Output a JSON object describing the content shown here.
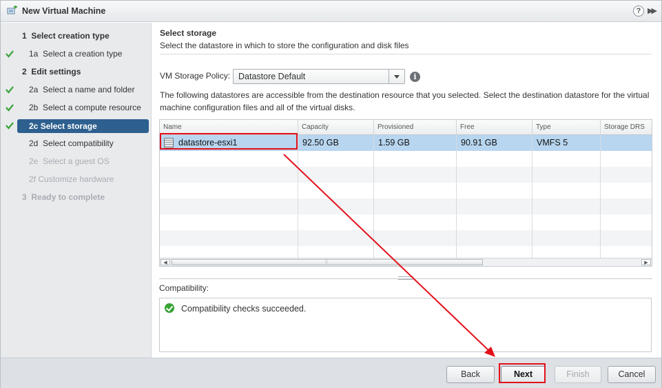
{
  "window": {
    "title": "New Virtual Machine",
    "help": "?",
    "expand": "▶▶"
  },
  "sidebar": {
    "steps": [
      {
        "num": "1",
        "label": "Select creation type"
      },
      {
        "num": "1a",
        "label": "Select a creation type"
      },
      {
        "num": "2",
        "label": "Edit settings"
      },
      {
        "num": "2a",
        "label": "Select a name and folder"
      },
      {
        "num": "2b",
        "label": "Select a compute resource"
      },
      {
        "num": "2c",
        "label": "Select storage"
      },
      {
        "num": "2d",
        "label": "Select compatibility"
      },
      {
        "num": "2e",
        "label": "Select a guest OS"
      },
      {
        "num": "2f",
        "label": "Customize hardware"
      },
      {
        "num": "3",
        "label": "Ready to complete"
      }
    ]
  },
  "main": {
    "title": "Select storage",
    "description": "Select the datastore in which to store the configuration and disk files",
    "policy_label": "VM Storage Policy:",
    "policy_value": "Datastore Default",
    "intro": "The following datastores are accessible from the destination resource that you selected. Select the destination datastore for the virtual machine configuration files and all of the virtual disks.",
    "columns": [
      "Name",
      "Capacity",
      "Provisioned",
      "Free",
      "Type",
      "Storage DRS"
    ],
    "rows": [
      {
        "name": "datastore-esxi1",
        "capacity": "92.50 GB",
        "provisioned": "1.59 GB",
        "free": "90.91 GB",
        "type": "VMFS 5",
        "drs": ""
      }
    ],
    "compat_label": "Compatibility:",
    "compat_message": "Compatibility checks succeeded."
  },
  "footer": {
    "back": "Back",
    "next": "Next",
    "finish": "Finish",
    "cancel": "Cancel"
  },
  "colors": {
    "highlight": "#e3101a",
    "selected_row": "#b8d6f0",
    "active_step": "#2d5f8f",
    "check": "#3aa337"
  }
}
